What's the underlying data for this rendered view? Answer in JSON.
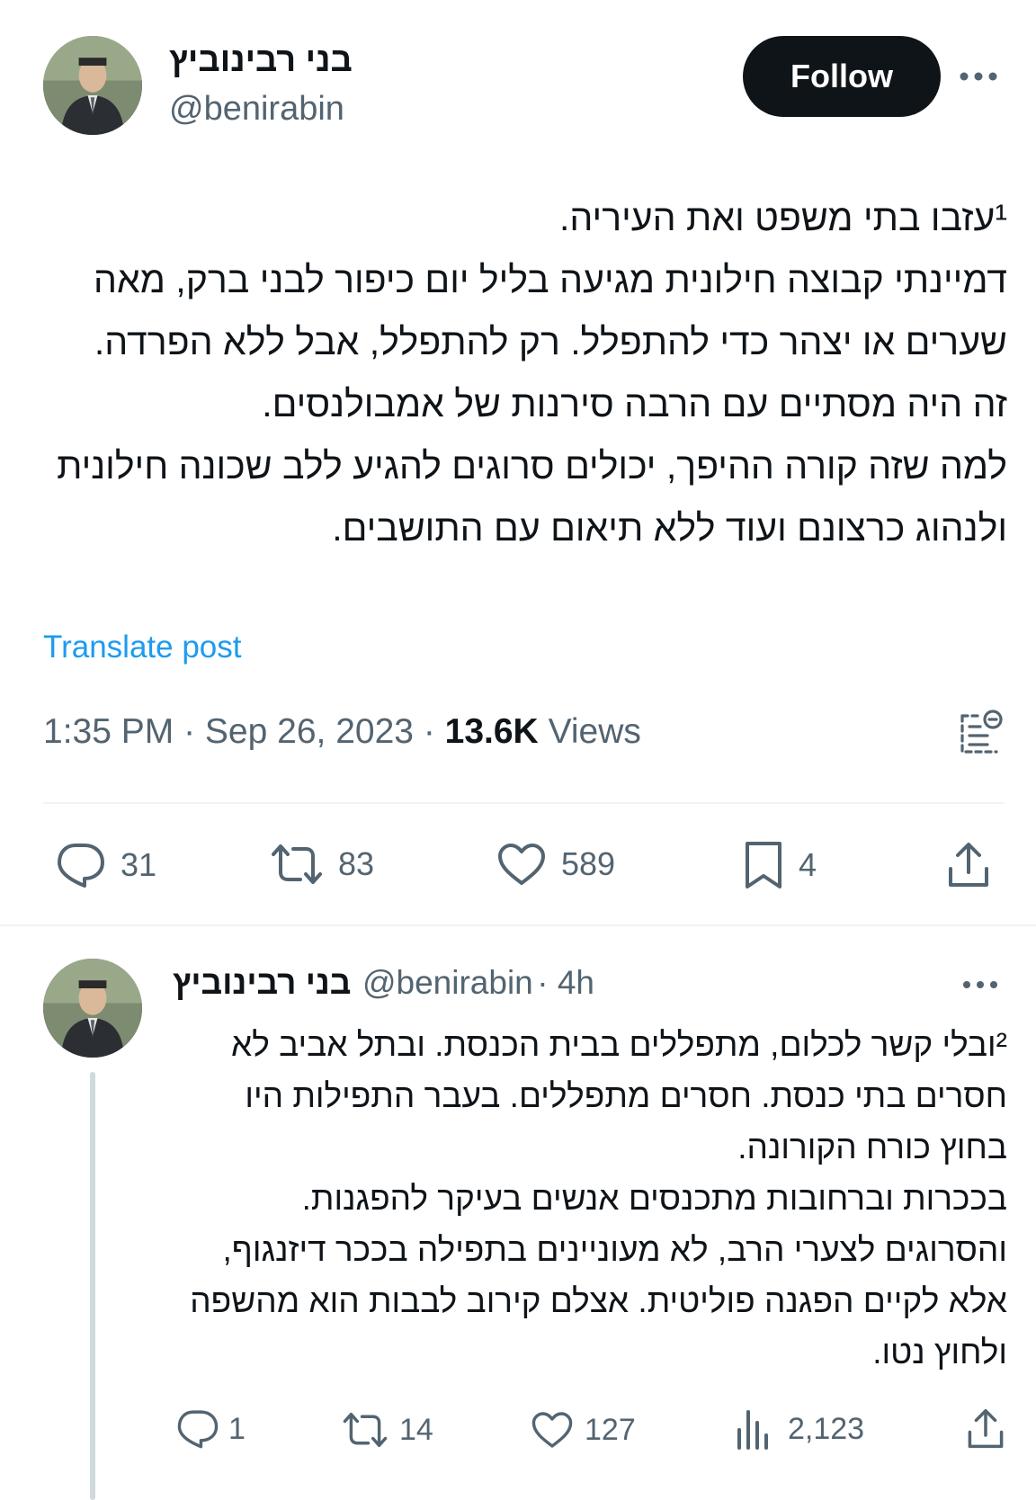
{
  "tweet": {
    "author_name": "בני רבינוביץ",
    "author_handle": "@benirabin",
    "follow_label": "Follow",
    "text": "¹עזבו בתי משפט ואת העיריה.\nדמיינתי קבוצה חילונית מגיעה בליל יום כיפור לבני ברק, מאה שערים או יצהר כדי להתפלל. רק להתפלל, אבל ללא הפרדה.\nזה היה מסתיים עם הרבה סירנות של אמבולנסים.\nלמה שזה קורה ההיפך, יכולים סרוגים להגיע ללב שכונה חילונית ולנהוג כרצונם ועוד ללא תיאום עם התושבים.",
    "translate_label": "Translate post",
    "time": "1:35 PM",
    "date": "Sep 26, 2023",
    "views_count": "13.6K",
    "views_label": "Views",
    "replies": "31",
    "reposts": "83",
    "likes": "589",
    "bookmarks": "4"
  },
  "reply": {
    "author_name": "בני רבינוביץ",
    "author_handle": "@benirabin",
    "age": "4h",
    "text": "²ובלי קשר לכלום, מתפללים בבית הכנסת. ובתל אביב לא חסרים בתי כנסת. חסרים מתפללים. בעבר התפילות היו בחוץ כורח הקורונה.\nבככרות וברחובות מתכנסים אנשים בעיקר להפגנות.\nוהסרוגים לצערי הרב, לא מעוניינים בתפילה בככר דיזנגוף, אלא לקיים הפגנה פוליטית. אצלם קירוב לבבות הוא מהשפה ולחוץ נטו.",
    "replies": "1",
    "reposts": "14",
    "likes": "127",
    "views": "2,123"
  },
  "icons": {
    "more": "more-horizontal-icon",
    "reply": "speech-bubble-icon",
    "repost": "repost-arrows-icon",
    "like": "heart-icon",
    "bookmark": "bookmark-icon",
    "share": "share-upload-icon",
    "analytics": "bar-chart-icon",
    "notes": "post-notes-icon"
  },
  "colors": {
    "link": "#1d9bf0",
    "secondary_text": "#536471",
    "primary_text": "#0f1419",
    "divider": "#eff3f4"
  }
}
